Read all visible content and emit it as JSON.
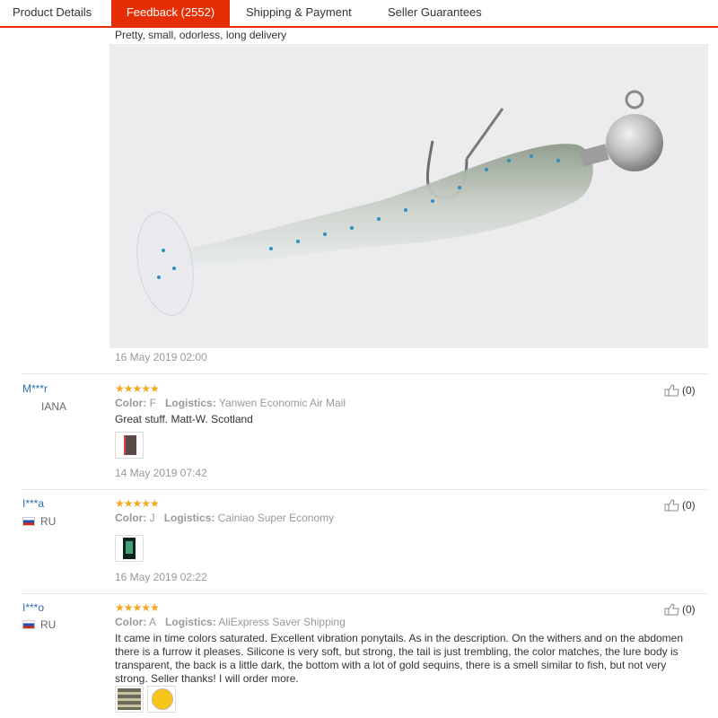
{
  "tabs": [
    {
      "label": "Product Details"
    },
    {
      "label": "Feedback (2552)"
    },
    {
      "label": "Shipping & Payment"
    },
    {
      "label": "Seller Guarantees"
    }
  ],
  "top_review": {
    "text": "Pretty, small, odorless, long delivery",
    "date": "16 May 2019 02:00"
  },
  "labels": {
    "color": "Color:",
    "logistics": "Logistics:",
    "stars": "★★★★★"
  },
  "reviews": [
    {
      "user": "M***r",
      "country": "IANA",
      "color": "F",
      "logistics": "Yanwen Economic Air Mail",
      "text": "Great stuff. Matt-W. Scotland",
      "date": "14 May 2019 07:42",
      "likes": "(0)"
    },
    {
      "user": "I***a",
      "country": "RU",
      "color": "J",
      "logistics": "Cainiao Super Economy",
      "text": "",
      "date": "16 May 2019 02:22",
      "likes": "(0)"
    },
    {
      "user": "I***o",
      "country": "RU",
      "color": "A",
      "logistics": "AliExpress Saver Shipping",
      "text": "It came in time colors saturated. Excellent vibration ponytails. As in the description. On the withers and on the abdomen there is a furrow it pleases. Silicone is very soft, but strong, the tail is just trembling, the color matches, the lure body is transparent, the back is a little dark, the bottom with a lot of gold sequins, there is a smell similar to fish, but not very strong. Seller thanks! I will order more.",
      "date": "",
      "likes": "(0)"
    }
  ],
  "colors": {
    "accent": "#e62e04",
    "star": "#f5a623",
    "link": "#2b6dad"
  }
}
